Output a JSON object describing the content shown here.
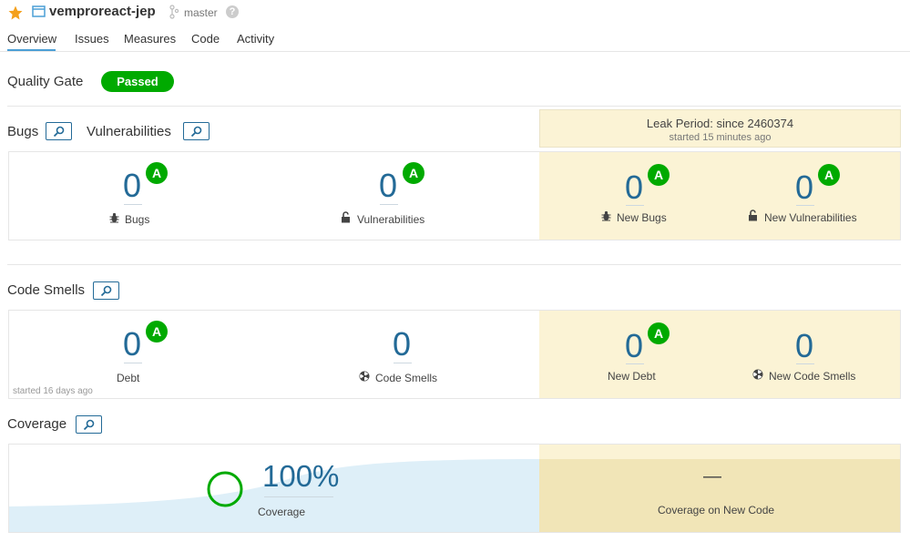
{
  "header": {
    "project_name": "vemproreact-jep",
    "branch": "master",
    "help": "?",
    "colors": {
      "star": "#f4a01b",
      "accent": "#4b9fd5"
    }
  },
  "nav": {
    "tabs": [
      {
        "label": "Overview",
        "active": true
      },
      {
        "label": "Issues"
      },
      {
        "label": "Measures"
      },
      {
        "label": "Code"
      },
      {
        "label": "Activity"
      }
    ]
  },
  "quality_gate": {
    "label": "Quality Gate",
    "status": "Passed",
    "status_color": "#00aa00"
  },
  "leak_period": {
    "title": "Leak Period: since 2460374",
    "started": "started 15 minutes ago",
    "background": "#fbf3d5"
  },
  "bugs_vulns": {
    "bugs_title": "Bugs",
    "vulns_title": "Vulnerabilities",
    "bugs": {
      "value": "0",
      "rating": "A",
      "label": "Bugs"
    },
    "vulnerabilities": {
      "value": "0",
      "rating": "A",
      "label": "Vulnerabilities"
    },
    "new_bugs": {
      "value": "0",
      "rating": "A",
      "label": "New Bugs"
    },
    "new_vulnerabilities": {
      "value": "0",
      "rating": "A",
      "label": "New Vulnerabilities"
    }
  },
  "code_smells": {
    "title": "Code Smells",
    "debt": {
      "value": "0",
      "rating": "A",
      "label": "Debt",
      "started": "started 16 days ago"
    },
    "smells": {
      "value": "0",
      "label": "Code Smells"
    },
    "new_debt": {
      "value": "0",
      "rating": "A",
      "label": "New Debt"
    },
    "new_smells": {
      "value": "0",
      "label": "New Code Smells"
    }
  },
  "coverage": {
    "title": "Coverage",
    "value": "100%",
    "label": "Coverage",
    "new_code_value": "—",
    "new_code_label": "Coverage on New Code",
    "coverage_fraction": 1.0
  }
}
